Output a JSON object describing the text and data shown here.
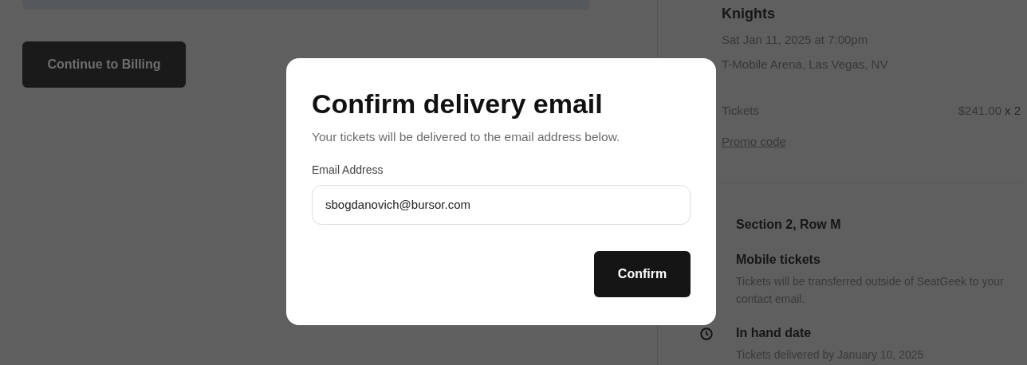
{
  "checkout": {
    "continue_button": "Continue to Billing"
  },
  "event": {
    "title": "Knights",
    "date": "Sat Jan 11, 2025 at 7:00pm",
    "venue": "T-Mobile Arena, Las Vegas, NV",
    "tickets_label": "Tickets",
    "price": "$241.00",
    "quantity": "x 2",
    "promo_link": "Promo code"
  },
  "details": [
    {
      "kind": "section",
      "title": "Section 2, Row M"
    },
    {
      "kind": "mobile",
      "title": "Mobile tickets",
      "text": "Tickets will be transferred outside of SeatGeek to your contact email."
    },
    {
      "kind": "date",
      "title": "In hand date",
      "text": "Tickets delivered by January 10, 2025"
    }
  ],
  "modal": {
    "title": "Confirm delivery email",
    "subtitle": "Your tickets will be delivered to the email address below.",
    "field_label": "Email Address",
    "email": "sbogdanovich@bursor.com",
    "confirm_button": "Confirm"
  }
}
